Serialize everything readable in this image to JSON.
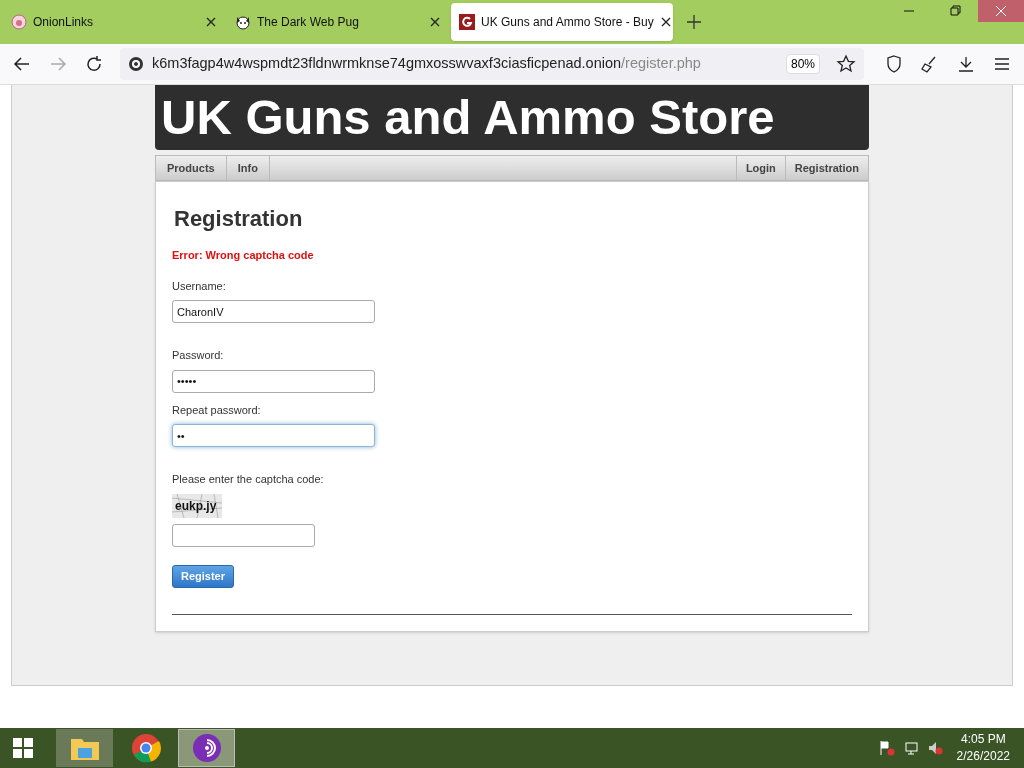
{
  "tabs": [
    {
      "title": "OnionLinks",
      "selected": false
    },
    {
      "title": "The Dark Web Pug",
      "selected": false
    },
    {
      "title": "UK Guns and Ammo Store - Buy",
      "selected": true
    }
  ],
  "address_bar": {
    "host": "k6m3fagp4w4wspmdt23fldnwrmknse74gmxosswvaxf3ciasficpenad.onion",
    "path": "/register.php",
    "zoom": "80%"
  },
  "site": {
    "banner": "UK Guns and Ammo Store",
    "nav_left": [
      "Products",
      "Info"
    ],
    "nav_right": [
      "Login",
      "Registration"
    ]
  },
  "form": {
    "heading": "Registration",
    "error": "Error: Wrong captcha code",
    "fields": [
      {
        "label": "Username:",
        "value": "CharonIV",
        "focused": false,
        "kind": "text"
      },
      {
        "label": "Password:",
        "value": "•••••",
        "focused": false,
        "kind": "text"
      },
      {
        "label": "Repeat password:",
        "value": "••",
        "focused": true,
        "kind": "text"
      },
      {
        "label": "Please enter the captcha code:",
        "captcha": "eukp.jy",
        "focused": false,
        "kind": "captcha"
      }
    ],
    "submit": "Register"
  },
  "taskbar": {
    "time": "4:05 PM",
    "date": "2/26/2022"
  }
}
